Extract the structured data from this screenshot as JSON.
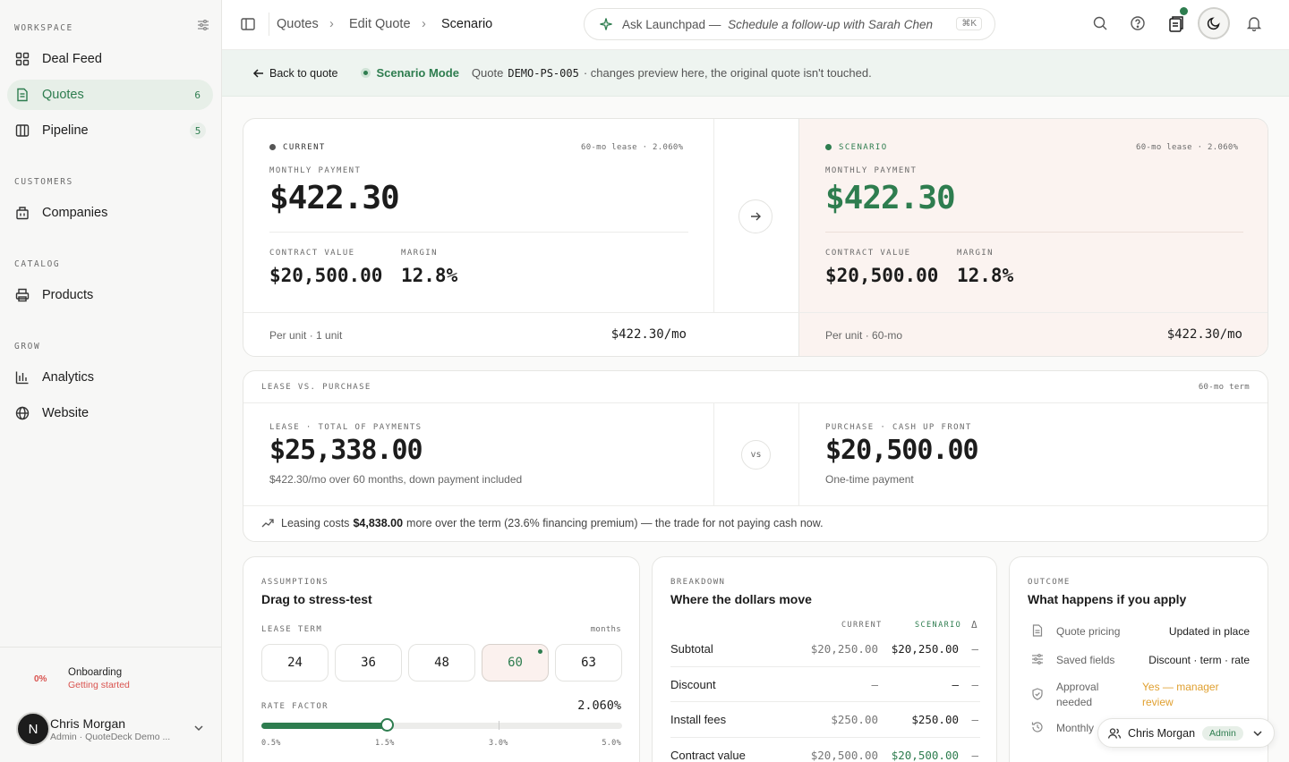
{
  "sidebar": {
    "workspace_label": "WORKSPACE",
    "deal_feed": "Deal Feed",
    "quotes": "Quotes",
    "quotes_count": "6",
    "pipeline": "Pipeline",
    "pipeline_count": "5",
    "customers_label": "CUSTOMERS",
    "companies": "Companies",
    "catalog_label": "CATALOG",
    "products": "Products",
    "grow_label": "GROW",
    "analytics": "Analytics",
    "website": "Website",
    "onboarding_pct": "0%",
    "onboarding_title": "Onboarding",
    "onboarding_sub": "Getting started",
    "avatar_letter": "N",
    "user_name": "Chris Morgan",
    "user_sub": "Admin · QuoteDeck Demo ..."
  },
  "topbar": {
    "crumb1": "Quotes",
    "crumb2": "Edit Quote",
    "crumb3": "Scenario",
    "ask_prefix": "Ask Launchpad — ",
    "ask_suggestion": "Schedule a follow-up with Sarah Chen",
    "ask_kbd": "⌘K"
  },
  "banner": {
    "back": "Back to quote",
    "mode": "Scenario Mode",
    "quote_prefix": "Quote",
    "quote_id": "DEMO-PS-005",
    "note": "· changes preview here, the original quote isn't touched."
  },
  "current": {
    "label": "CURRENT",
    "meta": "60-mo lease · 2.060%",
    "monthly_label": "MONTHLY PAYMENT",
    "monthly": "$422.30",
    "contract_label": "CONTRACT VALUE",
    "contract": "$20,500.00",
    "margin_label": "MARGIN",
    "margin": "12.8%",
    "foot_left": "Per unit · 1 unit",
    "foot_right": "$422.30/mo"
  },
  "scenario": {
    "label": "SCENARIO",
    "meta": "60-mo lease · 2.060%",
    "monthly_label": "MONTHLY PAYMENT",
    "monthly": "$422.30",
    "contract_label": "CONTRACT VALUE",
    "contract": "$20,500.00",
    "margin_label": "MARGIN",
    "margin": "12.8%",
    "foot_left": "Per unit · 60-mo",
    "foot_right": "$422.30/mo"
  },
  "lease_vs": {
    "title": "LEASE VS. PURCHASE",
    "term": "60-mo term",
    "lease_label": "LEASE · TOTAL OF PAYMENTS",
    "lease_total": "$25,338.00",
    "lease_sub": "$422.30/mo over 60 months, down payment included",
    "vs": "vs",
    "purchase_label": "PURCHASE · CASH UP FRONT",
    "purchase_total": "$20,500.00",
    "purchase_sub": "One-time payment",
    "summary_pre": "Leasing costs",
    "summary_amount": "$4,838.00",
    "summary_post": "more over the term (23.6% financing premium) — the trade for not paying cash now."
  },
  "assumptions": {
    "kicker": "ASSUMPTIONS",
    "title": "Drag to stress-test",
    "lease_term_label": "LEASE TERM",
    "months": "months",
    "terms": [
      "24",
      "36",
      "48",
      "60",
      "63"
    ],
    "selected_term": "60",
    "rate_label": "RATE FACTOR",
    "rate_value": "2.060%",
    "rate_min": 0.5,
    "rate_max": 5.0,
    "rate": 2.06,
    "ticks": [
      "0.5%",
      "1.5%",
      "3.0%",
      "5.0%"
    ]
  },
  "breakdown": {
    "kicker": "BREAKDOWN",
    "title": "Where the dollars move",
    "col_current": "CURRENT",
    "col_scenario": "SCENARIO",
    "col_delta": "Δ",
    "rows": [
      {
        "label": "Subtotal",
        "current": "$20,250.00",
        "scenario": "$20,250.00",
        "delta": "—"
      },
      {
        "label": "Discount",
        "current": "—",
        "scenario": "—",
        "delta": "—"
      },
      {
        "label": "Install fees",
        "current": "$250.00",
        "scenario": "$250.00",
        "delta": "—"
      },
      {
        "label": "Contract value",
        "current": "$20,500.00",
        "scenario": "$20,500.00",
        "delta": "—"
      }
    ]
  },
  "outcome": {
    "kicker": "OUTCOME",
    "title": "What happens if you apply",
    "rows": [
      {
        "label": "Quote pricing",
        "value": "Updated in place"
      },
      {
        "label": "Saved fields",
        "value": "Discount · term · rate"
      },
      {
        "label": "Approval needed",
        "value": "Yes — manager review"
      },
      {
        "label": "Monthly"
      }
    ]
  },
  "presence": {
    "name": "Chris Morgan",
    "role": "Admin"
  },
  "colors": {
    "accent": "#2e7d4f",
    "warning": "#e0a030",
    "scenario_bg": "#fbf3f0"
  }
}
